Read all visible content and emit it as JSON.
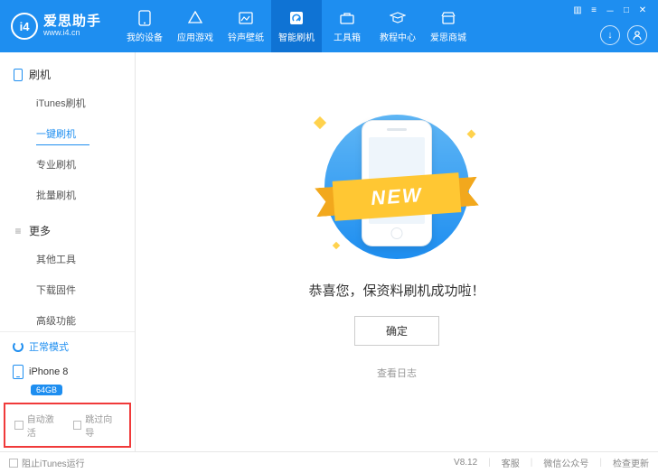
{
  "brand": {
    "logo_text": "i4",
    "name": "爱思助手",
    "url": "www.i4.cn"
  },
  "nav": {
    "items": [
      {
        "label": "我的设备"
      },
      {
        "label": "应用游戏"
      },
      {
        "label": "铃声壁纸"
      },
      {
        "label": "智能刷机"
      },
      {
        "label": "工具箱"
      },
      {
        "label": "教程中心"
      },
      {
        "label": "爱思商城"
      }
    ],
    "active_index": 3
  },
  "sidebar": {
    "groups": [
      {
        "title": "刷机",
        "items": [
          "iTunes刷机",
          "一键刷机",
          "专业刷机",
          "批量刷机"
        ],
        "active_index": 1
      },
      {
        "title": "更多",
        "items": [
          "其他工具",
          "下载固件",
          "高级功能"
        ],
        "active_index": -1
      }
    ],
    "mode_label": "正常模式",
    "device": {
      "name": "iPhone 8",
      "capacity": "64GB"
    },
    "checkboxes": {
      "auto_activate": "自动激活",
      "skip_guide": "跳过向导"
    }
  },
  "main": {
    "ribbon_text": "NEW",
    "success_text": "恭喜您，保资料刷机成功啦！",
    "ok_label": "确定",
    "log_link": "查看日志"
  },
  "statusbar": {
    "block_itunes": "阻止iTunes运行",
    "version": "V8.12",
    "service": "客服",
    "wechat": "微信公众号",
    "update": "检查更新"
  }
}
